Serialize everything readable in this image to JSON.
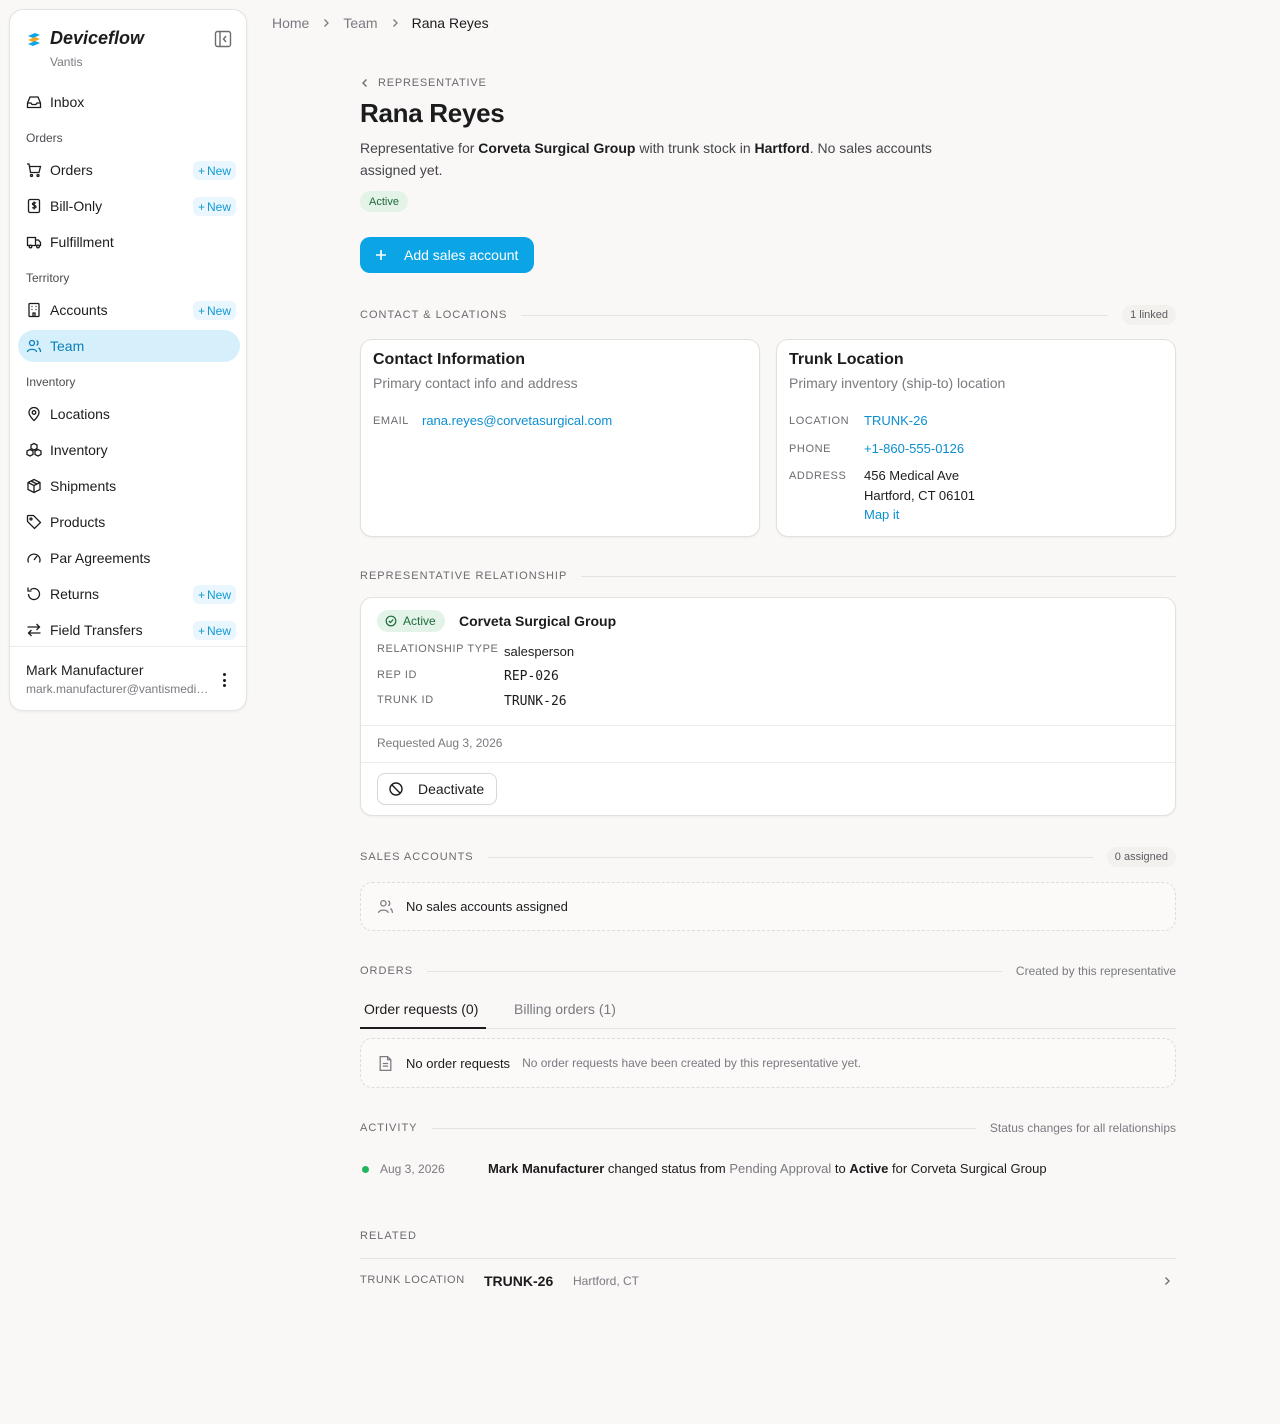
{
  "app": {
    "name": "Deviceflow",
    "org": "Vantis"
  },
  "sidebar": {
    "top_item": {
      "label": "Inbox",
      "icon": "inbox-icon"
    },
    "sections": [
      {
        "label": "Orders"
      },
      {
        "label": "Territory"
      },
      {
        "label": "Inventory"
      }
    ],
    "items": [
      {
        "label": "Orders",
        "icon": "cart-icon",
        "badge": "New"
      },
      {
        "label": "Bill-Only",
        "icon": "receipt-icon",
        "badge": "New"
      },
      {
        "label": "Fulfillment",
        "icon": "truck-icon"
      },
      {
        "label": "Accounts",
        "icon": "building-icon",
        "badge": "New"
      },
      {
        "label": "Team",
        "icon": "users-icon",
        "active": true
      },
      {
        "label": "Locations",
        "icon": "map-pin-icon"
      },
      {
        "label": "Inventory",
        "icon": "boxes-icon"
      },
      {
        "label": "Shipments",
        "icon": "package-icon"
      },
      {
        "label": "Products",
        "icon": "tag-icon"
      },
      {
        "label": "Par Agreements",
        "icon": "gauge-icon"
      },
      {
        "label": "Returns",
        "icon": "rotate-icon",
        "badge": "New"
      },
      {
        "label": "Field Transfers",
        "icon": "arrows-icon",
        "badge": "New"
      }
    ],
    "user": {
      "name": "Mark Manufacturer",
      "email": "mark.manufacturer@vantismedical.com"
    }
  },
  "breadcrumb": {
    "home": "Home",
    "team": "Team",
    "current": "Rana Reyes"
  },
  "header": {
    "back_label": "REPRESENTATIVE",
    "title": "Rana Reyes",
    "desc_prefix": "Representative for ",
    "desc_company": "Corveta Surgical Group",
    "desc_mid": " with trunk stock in ",
    "desc_city": "Hartford",
    "desc_suffix": ". No sales accounts assigned yet.",
    "status": "Active",
    "add_button": "Add sales account"
  },
  "contact_section": {
    "label": "CONTACT & LOCATIONS",
    "count": "1 linked",
    "contact_card": {
      "title": "Contact Information",
      "subtitle": "Primary contact info and address",
      "email_label": "EMAIL",
      "email": "rana.reyes@corvetasurgical.com"
    },
    "trunk_card": {
      "title": "Trunk Location",
      "subtitle": "Primary inventory (ship-to) location",
      "location_label": "LOCATION",
      "location": "TRUNK-26",
      "phone_label": "PHONE",
      "phone": "+1-860-555-0126",
      "address_label": "ADDRESS",
      "address_line1": "456 Medical Ave",
      "address_line2": "Hartford, CT 06101",
      "map_link": "Map it"
    }
  },
  "relationship": {
    "label": "REPRESENTATIVE RELATIONSHIP",
    "status": "Active",
    "company": "Corveta Surgical Group",
    "type_label": "RELATIONSHIP TYPE",
    "type": "salesperson",
    "rep_id_label": "REP ID",
    "rep_id": "REP-026",
    "trunk_id_label": "TRUNK ID",
    "trunk_id": "TRUNK-26",
    "requested": "Requested Aug 3, 2026",
    "deactivate": "Deactivate"
  },
  "sales_accounts": {
    "label": "SALES ACCOUNTS",
    "count": "0 assigned",
    "empty": "No sales accounts assigned"
  },
  "orders": {
    "label": "ORDERS",
    "meta": "Created by this representative",
    "tabs": [
      {
        "label": "Order requests (0)",
        "active": true
      },
      {
        "label": "Billing orders (1)",
        "active": false
      }
    ],
    "empty_title": "No order requests",
    "empty_desc": "No order requests have been created by this representative yet."
  },
  "activity": {
    "label": "ACTIVITY",
    "meta": "Status changes for all relationships",
    "entries": [
      {
        "date": "Aug 3, 2026",
        "actor": "Mark Manufacturer",
        "verb": " changed status from ",
        "from": "Pending Approval",
        "to_word": " to ",
        "to": "Active",
        "for_word": " for ",
        "target": "Corveta Surgical Group"
      }
    ]
  },
  "related": {
    "label": "RELATED",
    "row_label": "TRUNK LOCATION",
    "row_value": "TRUNK-26",
    "row_meta": "Hartford, CT"
  },
  "colors": {
    "accent": "#0ba4e5",
    "active_nav_bg": "#d6f0fb",
    "success": "#22b55d",
    "link": "#0b8fd0"
  }
}
